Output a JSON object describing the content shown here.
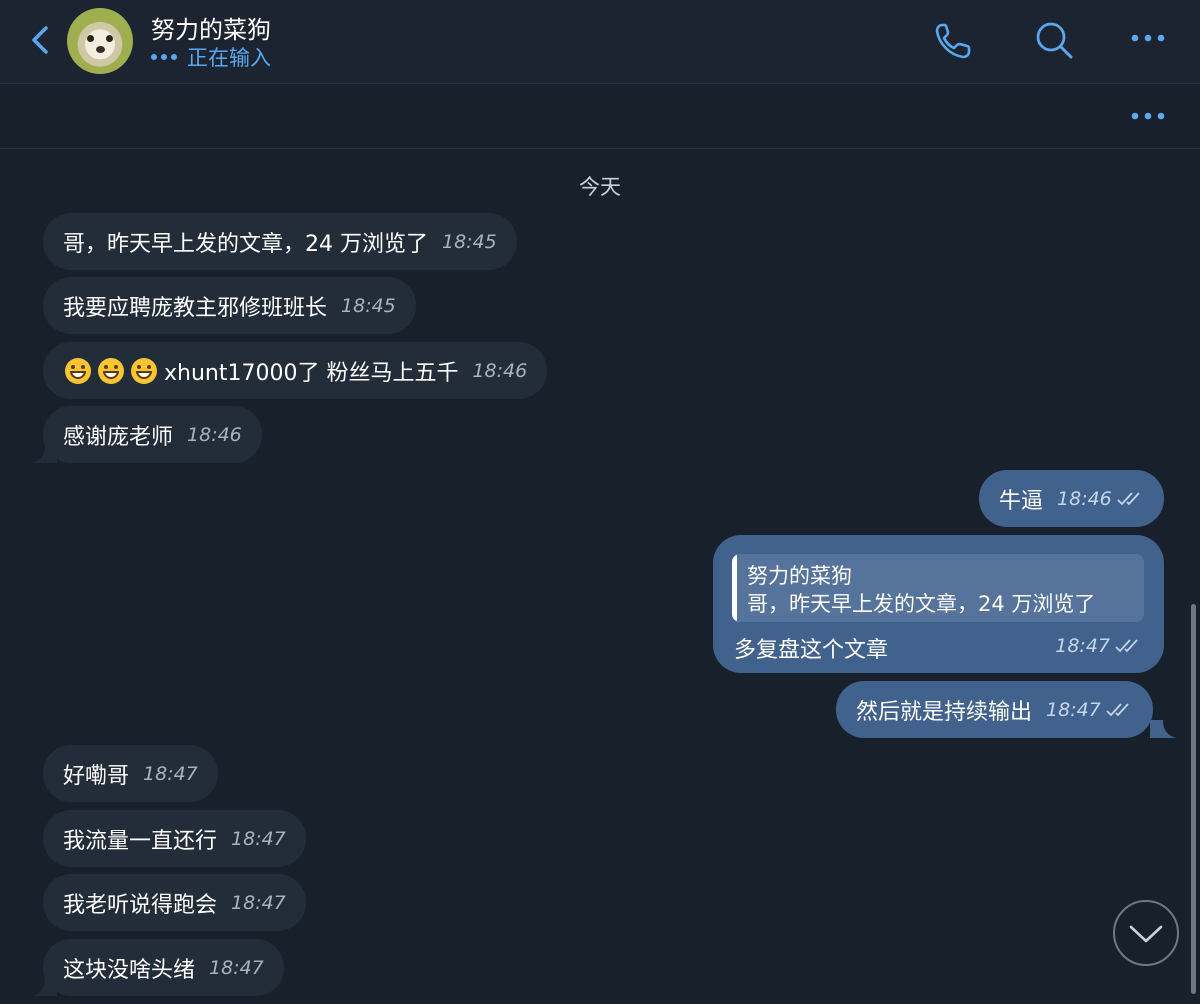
{
  "header": {
    "title": "努力的菜狗",
    "status": "正在输入"
  },
  "date_divider": "今天",
  "incoming_group1": [
    {
      "text": "哥，昨天早上发的文章，24 万浏览了",
      "time": "18:45"
    },
    {
      "text": "我要应聘庞教主邪修班班长",
      "time": "18:45"
    },
    {
      "text": "xhunt17000了 粉丝马上五千",
      "time": "18:46",
      "emoji_prefix_count": 3
    },
    {
      "text": "感谢庞老师",
      "time": "18:46"
    }
  ],
  "outgoing": [
    {
      "text": "牛逼",
      "time": "18:46"
    },
    {
      "text": "多复盘这个文章",
      "time": "18:47",
      "reply_to": {
        "name": "努力的菜狗",
        "text": "哥，昨天早上发的文章，24 万浏览了"
      }
    },
    {
      "text": "然后就是持续输出",
      "time": "18:47"
    }
  ],
  "incoming_group2": [
    {
      "text": "好嘞哥",
      "time": "18:47"
    },
    {
      "text": "我流量一直还行",
      "time": "18:47"
    },
    {
      "text": "我老听说得跑会",
      "time": "18:47"
    },
    {
      "text": "这块没啥头绪",
      "time": "18:47"
    }
  ],
  "colors": {
    "background": "#18202b",
    "incoming_bubble": "#232d3a",
    "outgoing_bubble": "#41628d",
    "accent": "#5aa8f0"
  },
  "icons": [
    "back-chevron-icon",
    "phone-icon",
    "search-icon",
    "more-icon",
    "scroll-down-icon",
    "read-ticks-icon"
  ]
}
